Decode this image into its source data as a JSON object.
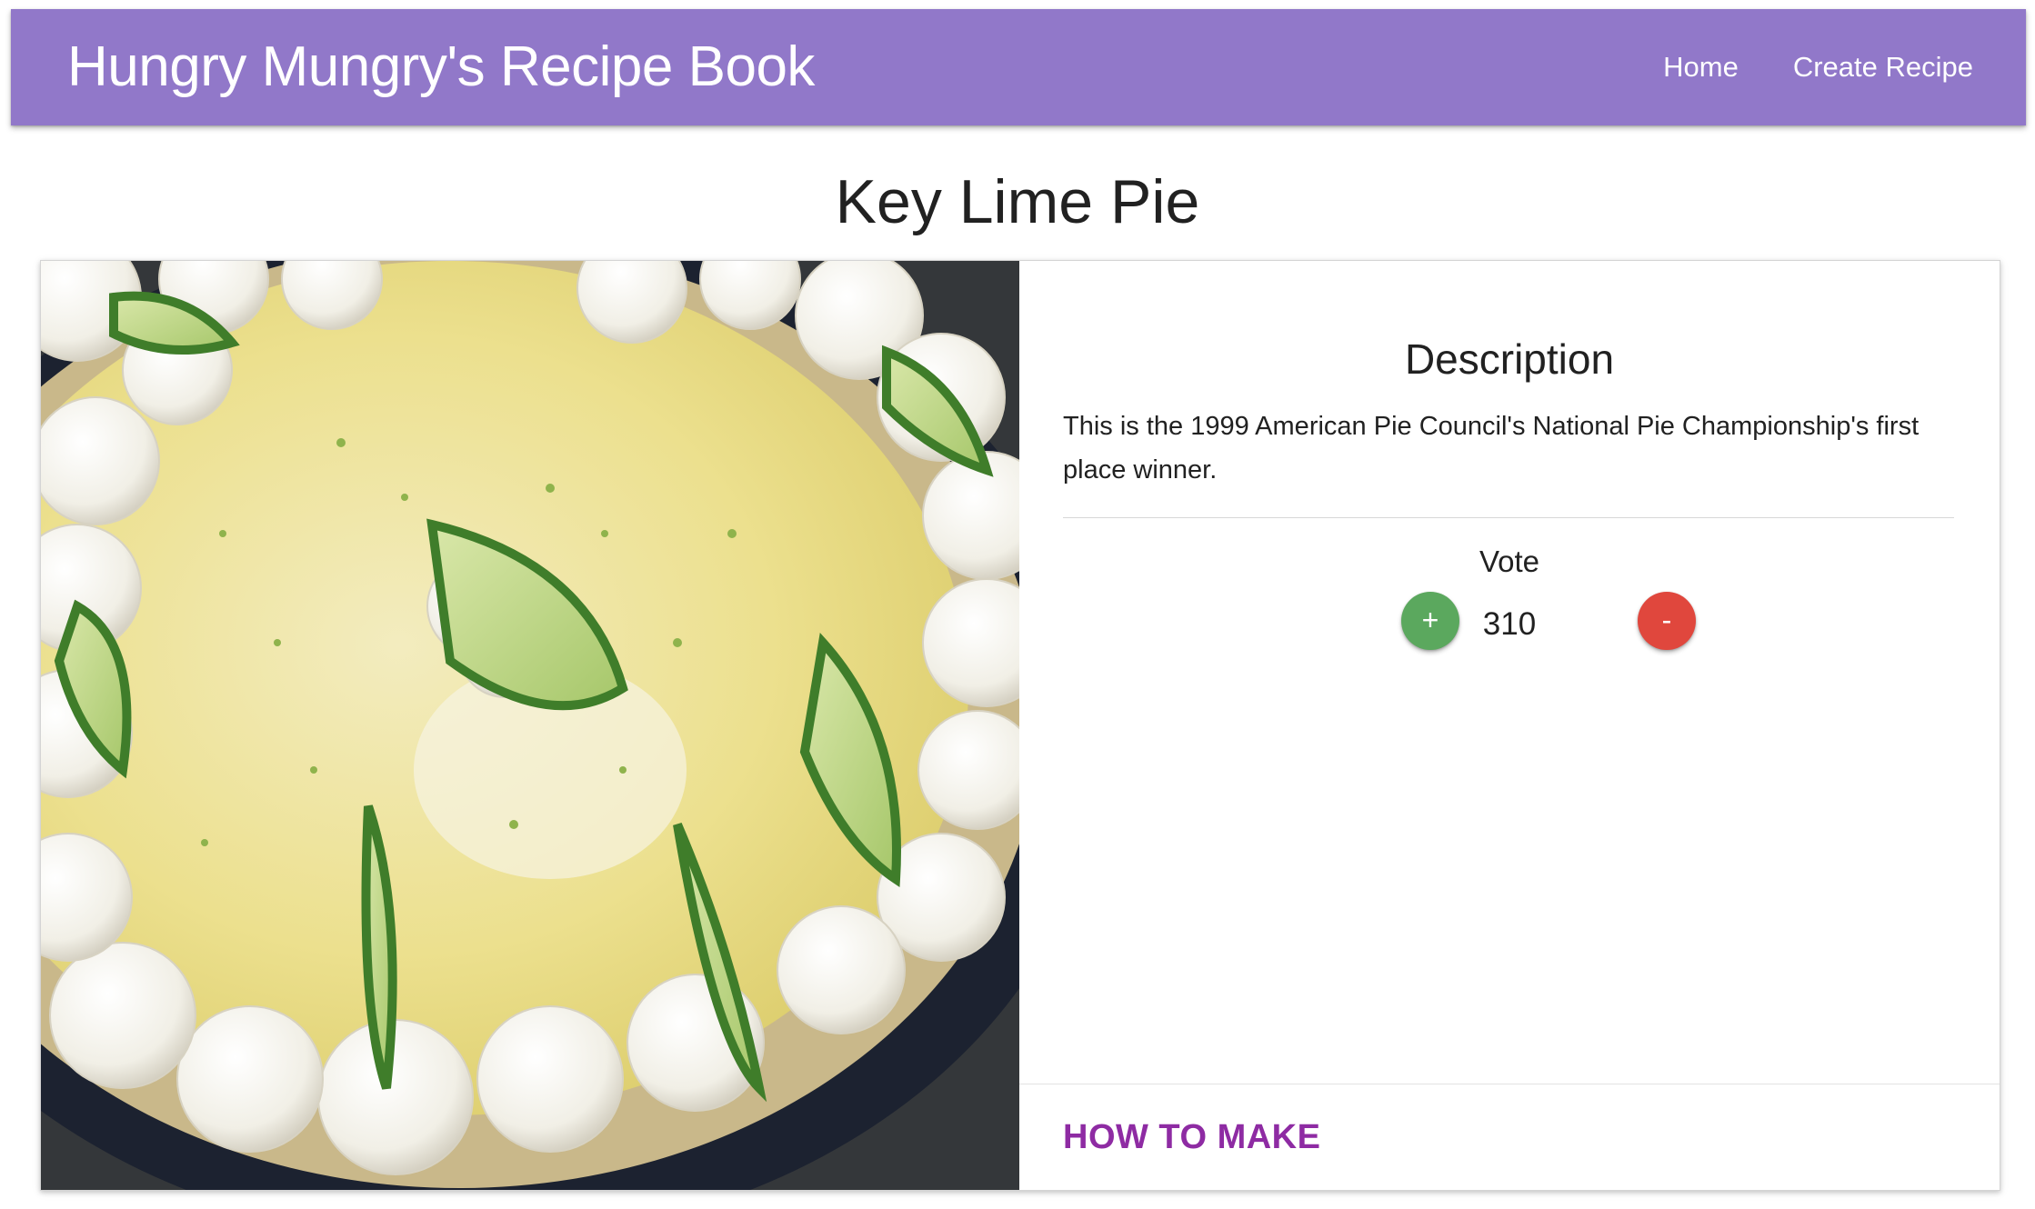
{
  "navbar": {
    "brand": "Hungry Mungry's Recipe Book",
    "links": [
      "Home",
      "Create Recipe"
    ],
    "background_color": "#9178c9"
  },
  "recipe": {
    "title": "Key Lime Pie",
    "image_alt": "key-lime-pie-photo",
    "description_heading": "Description",
    "description": "This is the 1999 American Pie Council's National Pie Championship's first place winner.",
    "vote_label": "Vote",
    "vote_count": "310",
    "upvote_label": "+",
    "downvote_label": "-",
    "action_label": "HOW TO MAKE",
    "upvote_color": "#5ba85e",
    "downvote_color": "#e0473d",
    "action_color": "#8e2ba3"
  }
}
